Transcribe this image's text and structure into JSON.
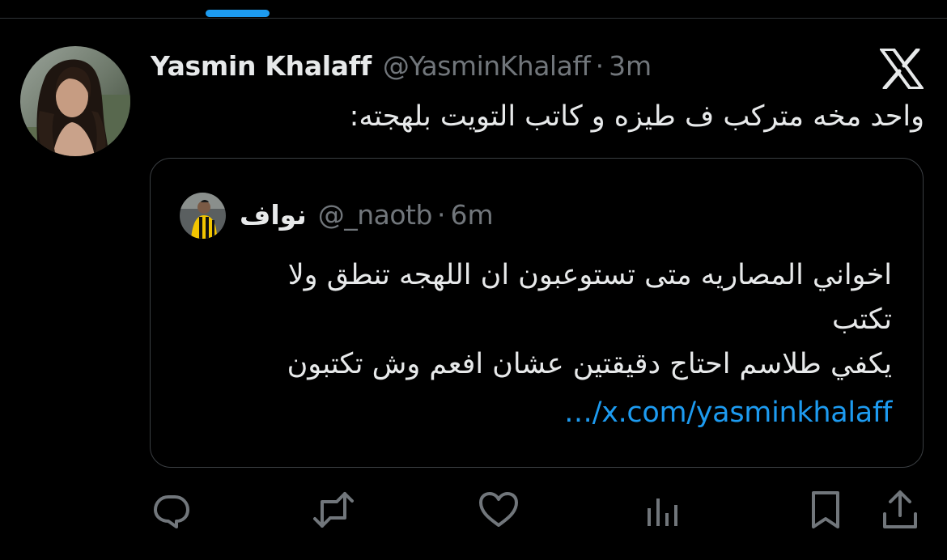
{
  "tweet": {
    "display_name": "Yasmin Khalaff",
    "handle": "@YasminKhalaff",
    "separator": "·",
    "time": "3m",
    "text": "واحد مخه متركب ف طيزه و كاتب التويت بلهجته:",
    "avatar_icon": "profile-photo-woman-curly-hair"
  },
  "quote": {
    "display_name": "نواف",
    "handle": "@_naotb",
    "separator": "·",
    "time": "6m",
    "text_lines": [
      "اخواني المصاريه متى تستوعبون ان اللهجه تنطق ولا",
      "تكتب",
      "يكفي طلاسم احتاج دقيقتين عشان افعم وش تكتبون"
    ],
    "link": "…/x.com/yasminkhalaff",
    "avatar_icon": "profile-photo-football-player"
  },
  "actions": {
    "icons": [
      "reply-icon",
      "retweet-icon",
      "like-icon",
      "views-icon",
      "bookmark-icon",
      "share-icon"
    ]
  },
  "colors": {
    "background": "#000000",
    "text_primary": "#e7e9ea",
    "text_secondary": "#71767b",
    "accent": "#1d9bf0",
    "border": "#3a3e42"
  }
}
